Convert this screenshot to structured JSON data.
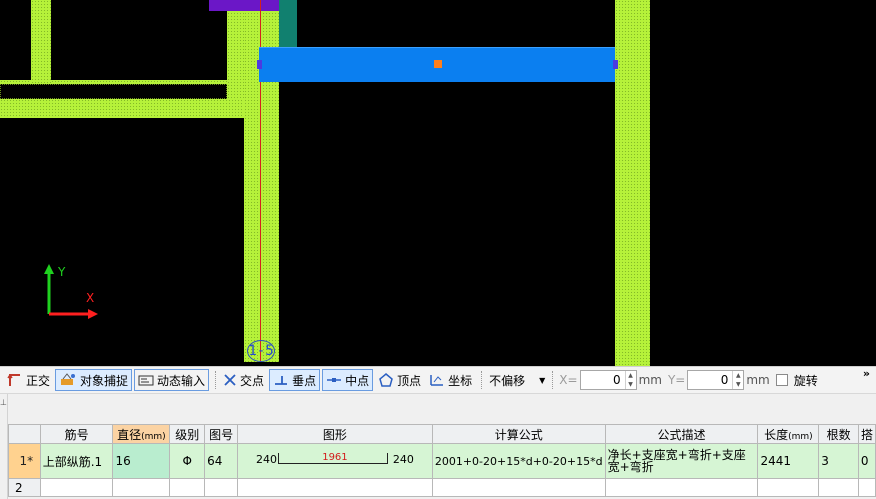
{
  "canvas": {
    "axis_label": "1-5",
    "ucs": {
      "y_label": "Y",
      "x_label": "X"
    },
    "colors": {
      "wall": "#b6f23a",
      "beam": "#0b7ff0",
      "axis_line": "#d4221b",
      "background": "#000000"
    }
  },
  "toolbar": {
    "ortho": "正交",
    "object_snap": "对象捕捉",
    "dynamic_input": "动态输入",
    "intersection": "交点",
    "perpendicular": "垂点",
    "midpoint": "中点",
    "vertex": "顶点",
    "coordinate": "坐标",
    "offset_select": "不偏移",
    "x_label": "X=",
    "x_value": "0",
    "x_unit": "mm",
    "y_label": "Y=",
    "y_value": "0",
    "y_unit": "mm",
    "rotate": "旋转",
    "overflow": "»"
  },
  "grid": {
    "columns": [
      "筋号",
      "直径",
      "(mm)",
      "级别",
      "图号",
      "图形",
      "计算公式",
      "公式描述",
      "长度",
      "(mm)",
      "根数",
      "搭"
    ],
    "rows": [
      {
        "index": "1*",
        "bar_name": "上部纵筋.1",
        "diameter": "16",
        "grade": "Φ",
        "figure_no": "64",
        "shape_left": "240",
        "shape_mid": "1961",
        "shape_right": "240",
        "formula": "2001+0-20+15*d+0-20+15*d",
        "description": "净长+支座宽+弯折+支座宽+弯折",
        "length": "2441",
        "count": "3",
        "lap": "0"
      },
      {
        "index": "2"
      }
    ]
  }
}
